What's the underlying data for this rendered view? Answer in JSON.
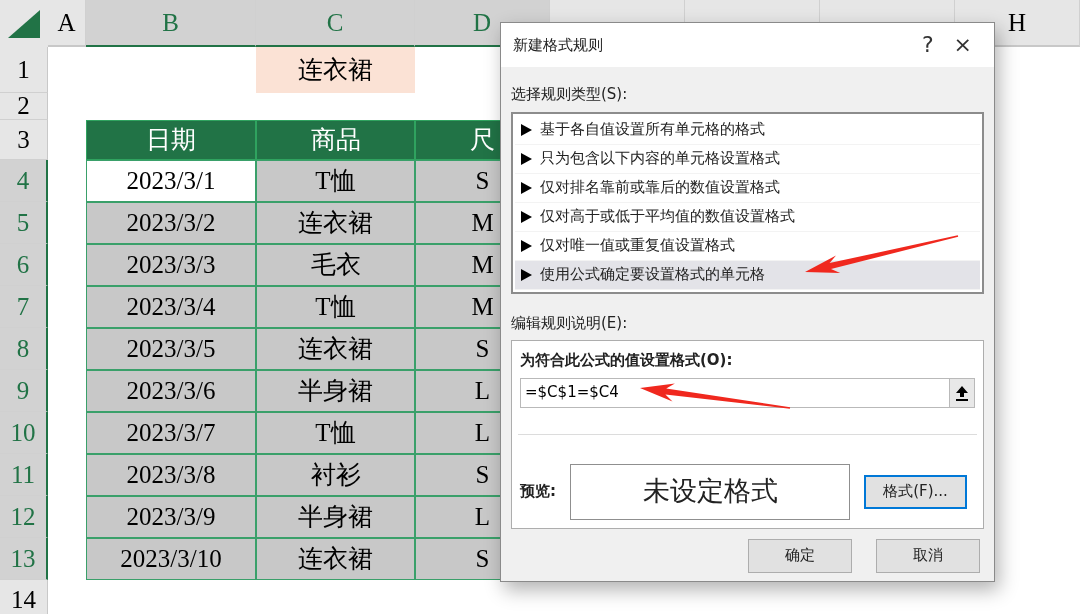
{
  "sheet": {
    "column_headers": [
      {
        "label": "A",
        "selected": false
      },
      {
        "label": "B",
        "selected": true
      },
      {
        "label": "C",
        "selected": true
      },
      {
        "label": "D",
        "selected": true
      }
    ],
    "column_headers_right": [
      {
        "label": "H",
        "selected": false
      }
    ],
    "row_headers": [
      {
        "label": "1",
        "selected": false
      },
      {
        "label": "2",
        "selected": false
      },
      {
        "label": "3",
        "selected": false
      },
      {
        "label": "4",
        "selected": true
      },
      {
        "label": "5",
        "selected": true
      },
      {
        "label": "6",
        "selected": true
      },
      {
        "label": "7",
        "selected": true
      },
      {
        "label": "8",
        "selected": true
      },
      {
        "label": "9",
        "selected": true
      },
      {
        "label": "10",
        "selected": true
      },
      {
        "label": "11",
        "selected": true
      },
      {
        "label": "12",
        "selected": true
      },
      {
        "label": "13",
        "selected": true
      },
      {
        "label": "14",
        "selected": false
      }
    ],
    "criteria_cell": "连衣裙",
    "table": {
      "columns": [
        "日期",
        "商品",
        "尺"
      ],
      "rows": [
        {
          "date": "2023/3/1",
          "product": "T恤",
          "size": "S",
          "active": true
        },
        {
          "date": "2023/3/2",
          "product": "连衣裙",
          "size": "M",
          "active": false
        },
        {
          "date": "2023/3/3",
          "product": "毛衣",
          "size": "M",
          "active": false
        },
        {
          "date": "2023/3/4",
          "product": "T恤",
          "size": "M",
          "active": false
        },
        {
          "date": "2023/3/5",
          "product": "连衣裙",
          "size": "S",
          "active": false
        },
        {
          "date": "2023/3/6",
          "product": "半身裙",
          "size": "L",
          "active": false
        },
        {
          "date": "2023/3/7",
          "product": "T恤",
          "size": "L",
          "active": false
        },
        {
          "date": "2023/3/8",
          "product": "衬衫",
          "size": "S",
          "active": false
        },
        {
          "date": "2023/3/9",
          "product": "半身裙",
          "size": "L",
          "active": false
        },
        {
          "date": "2023/3/10",
          "product": "连衣裙",
          "size": "S",
          "active": false
        }
      ]
    }
  },
  "dialog": {
    "title": "新建格式规则",
    "help": "?",
    "close": "×",
    "rule_type_label": "选择规则类型(S):",
    "rule_types": [
      {
        "label": "基于各自值设置所有单元格的格式",
        "selected": false
      },
      {
        "label": "只为包含以下内容的单元格设置格式",
        "selected": false
      },
      {
        "label": "仅对排名靠前或靠后的数值设置格式",
        "selected": false
      },
      {
        "label": "仅对高于或低于平均值的数值设置格式",
        "selected": false
      },
      {
        "label": "仅对唯一值或重复值设置格式",
        "selected": false
      },
      {
        "label": "使用公式确定要设置格式的单元格",
        "selected": true
      }
    ],
    "description_label": "编辑规则说明(E):",
    "formula_label": "为符合此公式的值设置格式(O):",
    "formula": "=$C$1=$C4",
    "preview_label": "预览:",
    "preview_text": "未设定格式",
    "format_button": "格式(F)...",
    "buttons": [
      "确定",
      "取消"
    ]
  },
  "annotations": [
    {
      "kind": "arrow"
    },
    {
      "kind": "arrow"
    }
  ]
}
